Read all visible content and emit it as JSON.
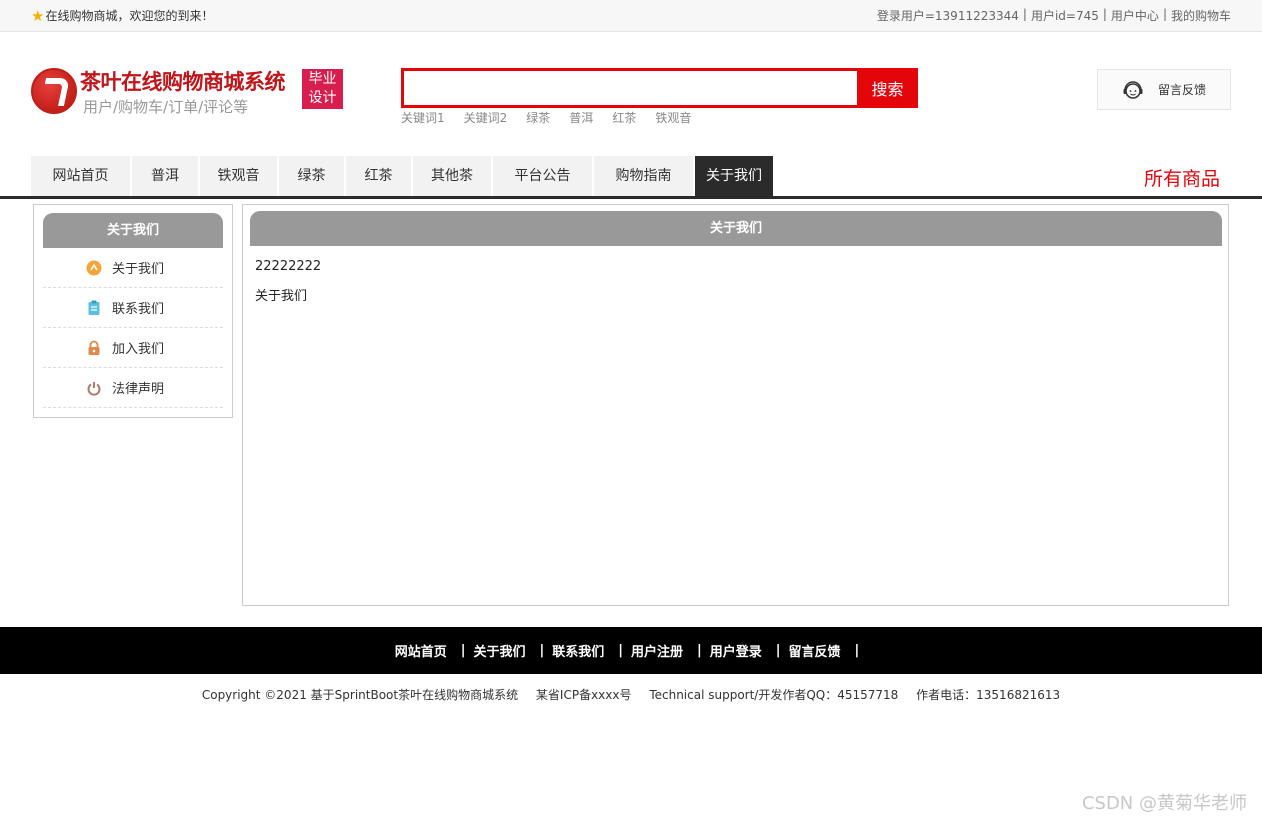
{
  "topbar": {
    "welcome": "在线购物商城，欢迎您的到来！",
    "user_links": [
      "登录用户=13911223344",
      "用户id=745",
      "用户中心",
      "我的购物车"
    ]
  },
  "header": {
    "title": "茶叶在线购物商城系统",
    "subtitle": "用户/购物车/订单/评论等",
    "badge_line1": "毕业",
    "badge_line2": "设计",
    "search_placeholder": "",
    "search_button": "搜索",
    "hot_keywords": [
      "关键词1",
      "关键词2",
      "绿茶",
      "普洱",
      "红茶",
      "铁观音"
    ],
    "feedback": "留言反馈"
  },
  "nav": {
    "items": [
      "网站首页",
      "普洱",
      "铁观音",
      "绿茶",
      "红茶",
      "其他茶",
      "平台公告",
      "购物指南",
      "关于我们"
    ],
    "active": "关于我们",
    "all_goods": "所有商品"
  },
  "sidebar": {
    "title": "关于我们",
    "items": [
      {
        "label": "关于我们",
        "icon": "orange-circle-icon"
      },
      {
        "label": "联系我们",
        "icon": "clipboard-icon"
      },
      {
        "label": "加入我们",
        "icon": "lock-icon"
      },
      {
        "label": "法律声明",
        "icon": "power-icon"
      }
    ]
  },
  "main": {
    "title": "关于我们",
    "line1": "22222222",
    "line2": "关于我们"
  },
  "footer": {
    "links": [
      "网站首页",
      "关于我们",
      "联系我们",
      "用户注册",
      "用户登录",
      "留言反馈"
    ],
    "copyright": [
      "Copyright ©2021 基于SprintBoot茶叶在线购物商城系统",
      "某省ICP备xxxx号",
      "Technical support/开发作者QQ：45157718",
      "作者电话：13516821613"
    ]
  },
  "watermark": "CSDN @黄菊华老师",
  "colors": {
    "accent": "#e4050b",
    "brand": "#c0161b",
    "nav_active": "#2b2b2b",
    "panel_head": "#999999"
  }
}
